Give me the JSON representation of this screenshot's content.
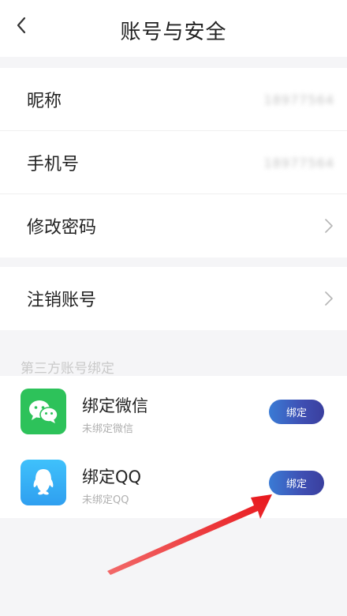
{
  "header": {
    "title": "账号与安全"
  },
  "account_group": {
    "nickname_label": "昵称",
    "nickname_value": "18977564",
    "phone_label": "手机号",
    "phone_value": "18977564",
    "change_password_label": "修改密码"
  },
  "cancel_group": {
    "cancel_account_label": "注销账号"
  },
  "third_party": {
    "section_title": "第三方账号绑定",
    "wechat": {
      "name": "绑定微信",
      "status": "未绑定微信",
      "button_label": "绑定"
    },
    "qq": {
      "name": "绑定QQ",
      "status": "未绑定QQ",
      "button_label": "绑定"
    }
  },
  "colors": {
    "wechat_green": "#2dc25a",
    "qq_blue": "#33b0f5",
    "button_blue": "#3f4fb3",
    "annotation_red": "#e8171c"
  },
  "icons": {
    "back": "chevron-left-icon",
    "row_arrow": "chevron-right-icon",
    "wechat": "wechat-icon",
    "qq": "qq-icon"
  }
}
